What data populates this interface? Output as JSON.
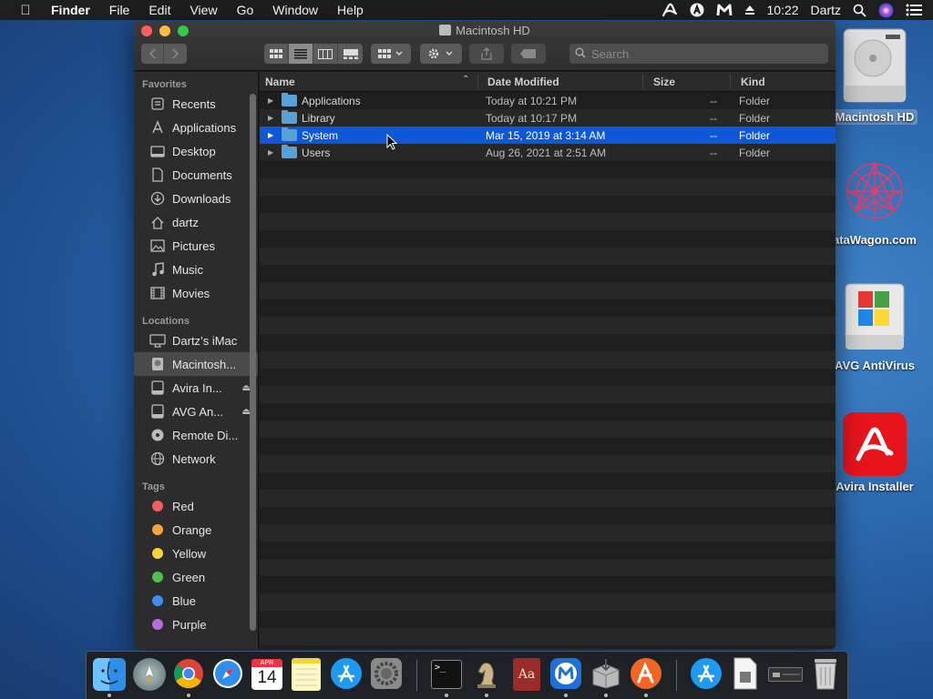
{
  "menubar": {
    "app_name": "Finder",
    "menus": [
      "File",
      "Edit",
      "View",
      "Go",
      "Window",
      "Help"
    ],
    "clock": "10:22",
    "user": "Dartz"
  },
  "window": {
    "title": "Macintosh HD",
    "search_placeholder": "Search"
  },
  "sidebar": {
    "favorites_header": "Favorites",
    "favorites": [
      {
        "label": "Recents",
        "icon": "clock-icon"
      },
      {
        "label": "Applications",
        "icon": "applications-icon"
      },
      {
        "label": "Desktop",
        "icon": "desktop-icon"
      },
      {
        "label": "Documents",
        "icon": "document-icon"
      },
      {
        "label": "Downloads",
        "icon": "download-icon"
      },
      {
        "label": "dartz",
        "icon": "home-icon"
      },
      {
        "label": "Pictures",
        "icon": "pictures-icon"
      },
      {
        "label": "Music",
        "icon": "music-icon"
      },
      {
        "label": "Movies",
        "icon": "movies-icon"
      }
    ],
    "locations_header": "Locations",
    "locations": [
      {
        "label": "Dartz’s iMac",
        "icon": "imac-icon"
      },
      {
        "label": "Macintosh...",
        "icon": "disk-icon",
        "selected": true
      },
      {
        "label": "Avira In...",
        "icon": "drive-icon",
        "eject": true
      },
      {
        "label": "AVG An...",
        "icon": "drive-icon",
        "eject": true
      },
      {
        "label": "Remote Di...",
        "icon": "remote-disc-icon"
      },
      {
        "label": "Network",
        "icon": "network-icon"
      }
    ],
    "tags_header": "Tags",
    "tags": [
      {
        "label": "Red",
        "color": "#f25f5c"
      },
      {
        "label": "Orange",
        "color": "#f7a23a"
      },
      {
        "label": "Yellow",
        "color": "#f5d33c"
      },
      {
        "label": "Green",
        "color": "#4cc250"
      },
      {
        "label": "Blue",
        "color": "#3a8ff1"
      },
      {
        "label": "Purple",
        "color": "#b76de0"
      }
    ]
  },
  "columns": {
    "name": "Name",
    "date": "Date Modified",
    "size": "Size",
    "kind": "Kind"
  },
  "files": [
    {
      "name": "Applications",
      "date": "Today at 10:21 PM",
      "size": "--",
      "kind": "Folder"
    },
    {
      "name": "Library",
      "date": "Today at 10:17 PM",
      "size": "--",
      "kind": "Folder"
    },
    {
      "name": "System",
      "date": "Mar 15, 2019 at 3:14 AM",
      "size": "--",
      "kind": "Folder",
      "selected": true
    },
    {
      "name": "Users",
      "date": "Aug 26, 2021 at 2:51 AM",
      "size": "--",
      "kind": "Folder"
    }
  ],
  "desktop": [
    {
      "label": "Macintosh HD",
      "icon": "hard-disk-icon"
    },
    {
      "label": "ataWagon.com",
      "icon": "datawagon-icon"
    },
    {
      "label": "AVG AntiVirus",
      "icon": "avg-installer-icon"
    },
    {
      "label": "Avira Installer",
      "icon": "avira-icon"
    }
  ],
  "dock": {
    "calendar_month": "APR",
    "calendar_day": "14"
  }
}
